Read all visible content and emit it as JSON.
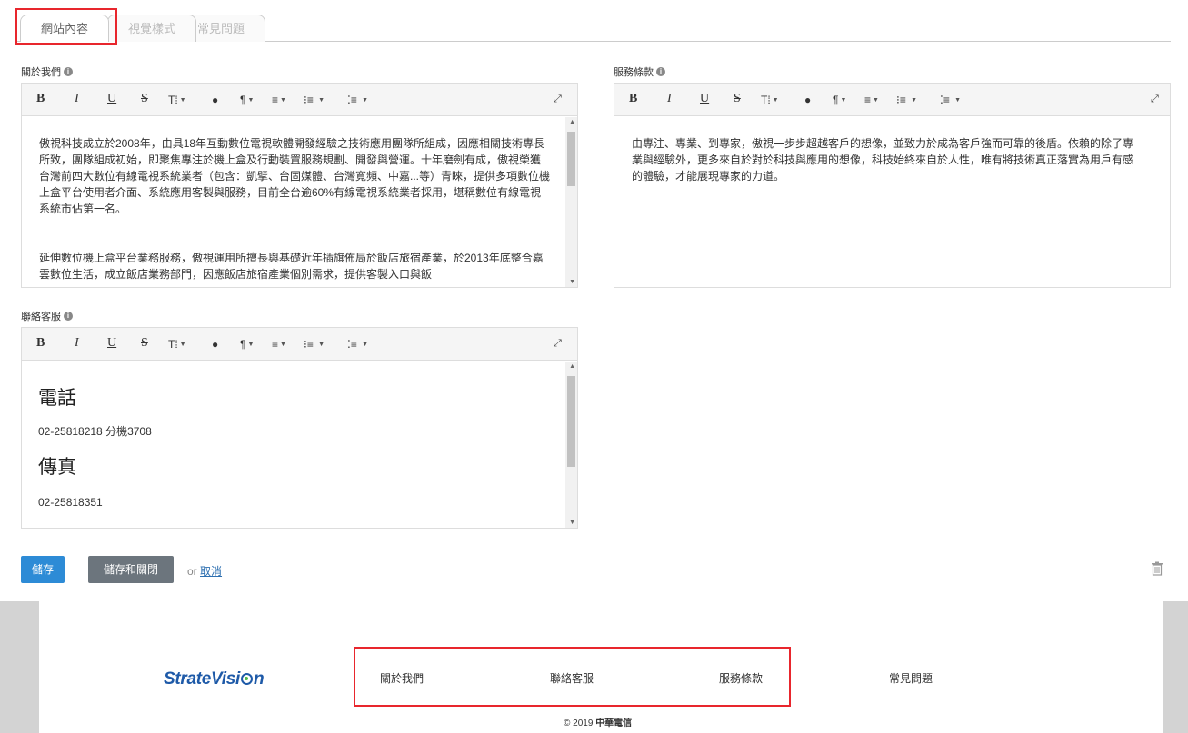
{
  "tabs": [
    "網站內容",
    "視覺樣式",
    "常見問題"
  ],
  "fields": {
    "about": {
      "label": "關於我們",
      "paragraphs": [
        "傲視科技成立於2008年，由具18年互動數位電視軟體開發經驗之技術應用團隊所組成，因應相關技術專長所致，團隊組成初始，即聚焦專注於機上盒及行動裝置服務規劃、開發與營運。十年磨劍有成，傲視榮獲台灣前四大數位有線電視系統業者（包含：凱擘、台固媒體、台灣寬頻、中嘉...等）青睞，提供多項數位機上盒平台使用者介面、系統應用客製與服務，目前全台逾60%有線電視系統業者採用，堪稱數位有線電視系統市佔第一名。",
        "延伸數位機上盒平台業務服務，傲視運用所擅長與基礎近年插旗佈局於飯店旅宿產業，於2013年底整合嘉雲數位生活，成立飯店業務部門，因應飯店旅宿產業個別需求，提供客製入口與飯"
      ]
    },
    "terms": {
      "label": "服務條款",
      "paragraphs": [
        "由專注、專業、到專家，傲視一步步超越客戶的想像，並致力於成為客戶強而可靠的後盾。依賴的除了專業與經驗外，更多來自於對於科技與應用的想像，科技始終來自於人性，唯有將技術真正落實為用戶有感的體驗，才能展現專家的力道。"
      ]
    },
    "contact": {
      "label": "聯絡客服",
      "phone_heading": "電話",
      "phone_value": "02-25818218 分機3708",
      "fax_heading": "傳真",
      "fax_value": "02-25818351"
    }
  },
  "toolbar": {
    "bold": "B",
    "italic": "I",
    "underline": "U",
    "strike": "S",
    "font_size": "T⁞",
    "color": "💧",
    "paragraph": "¶",
    "align": "≡",
    "ordered_list": "⁝≡",
    "unordered_list": "⁚≡",
    "expand": "⤢"
  },
  "actions": {
    "save": "儲存",
    "save_close": "儲存和關閉",
    "or": "or",
    "cancel": "取消"
  },
  "footer": {
    "logo_pre": "StrateVisi",
    "logo_post": "n",
    "links": [
      "關於我們",
      "聯絡客服",
      "服務條款",
      "常見問題"
    ],
    "copyright_prefix": "© 2019",
    "copyright_company": "中華電信"
  },
  "colors": {
    "primary": "#2d8bd6",
    "secondary": "#6c757d",
    "highlight": "#e8262d",
    "logo": "#1e5aa8"
  }
}
